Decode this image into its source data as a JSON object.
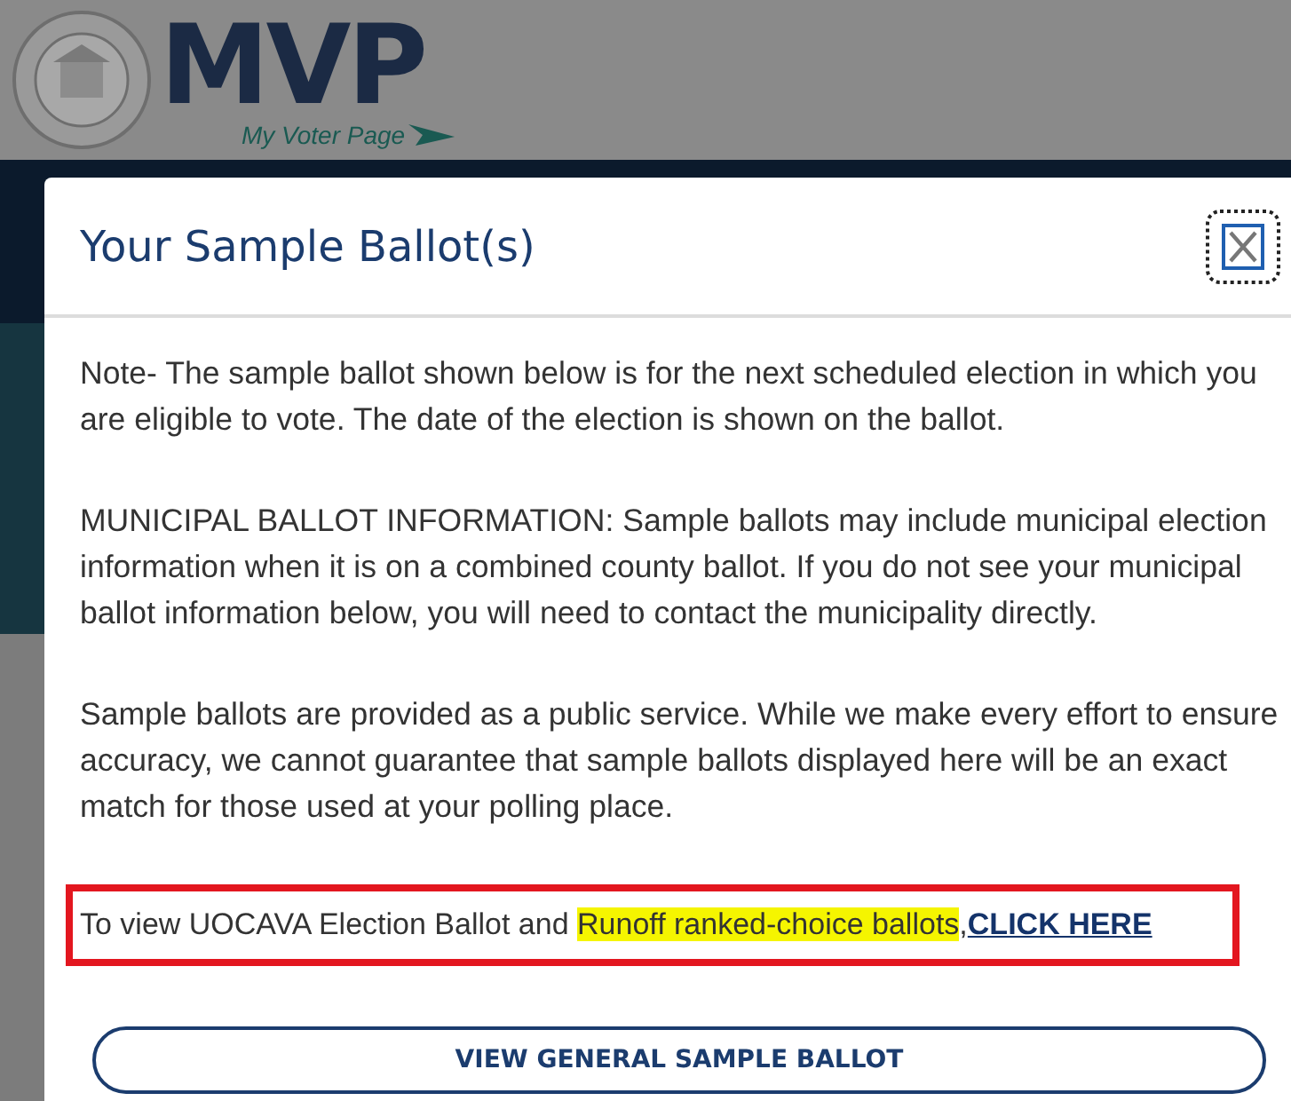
{
  "header": {
    "logo": "MVP",
    "tagline": "My Voter Page"
  },
  "modal": {
    "title": "Your Sample Ballot(s)",
    "paragraphs": [
      "Note- The sample ballot shown below is for the next scheduled election in which you are eligible to vote. The date of the election is shown on the ballot.",
      "MUNICIPAL BALLOT INFORMATION: Sample ballots may include municipal election information when it is on a combined county ballot. If you do not see your municipal ballot information below, you will need to contact the municipality directly.",
      "Sample ballots are provided as a public service. While we make every effort to ensure accuracy, we cannot guarantee that sample ballots displayed here will be an exact match for those used at your polling place."
    ],
    "notice": {
      "text": "To view UOCAVA Election Ballot and ",
      "highlighted": "Runoff ranked-choice ballots",
      "after": ",",
      "link": "CLICK HERE"
    },
    "button": "VIEW GENERAL SAMPLE BALLOT"
  }
}
